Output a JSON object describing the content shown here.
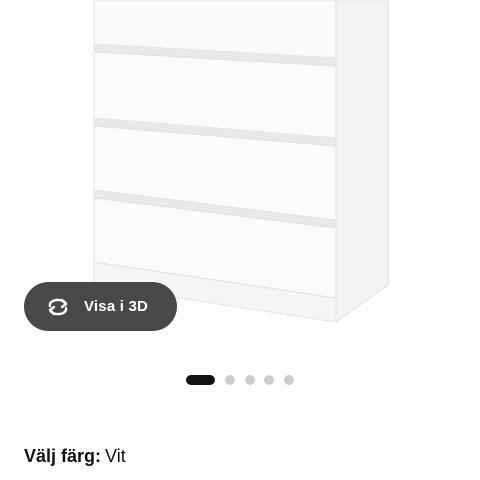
{
  "product_image": {
    "alt_icon": "dresser-image"
  },
  "view_3d": {
    "label": "Visa i 3D",
    "icon": "rotate-3d-icon"
  },
  "carousel": {
    "total": 5,
    "active_index": 0
  },
  "color_selector": {
    "key": "Välj färg:",
    "value": "Vit"
  },
  "colors": {
    "button_bg": "#484848",
    "dot_active": "#111111",
    "dot_inactive": "#cccccc",
    "text": "#111111"
  }
}
